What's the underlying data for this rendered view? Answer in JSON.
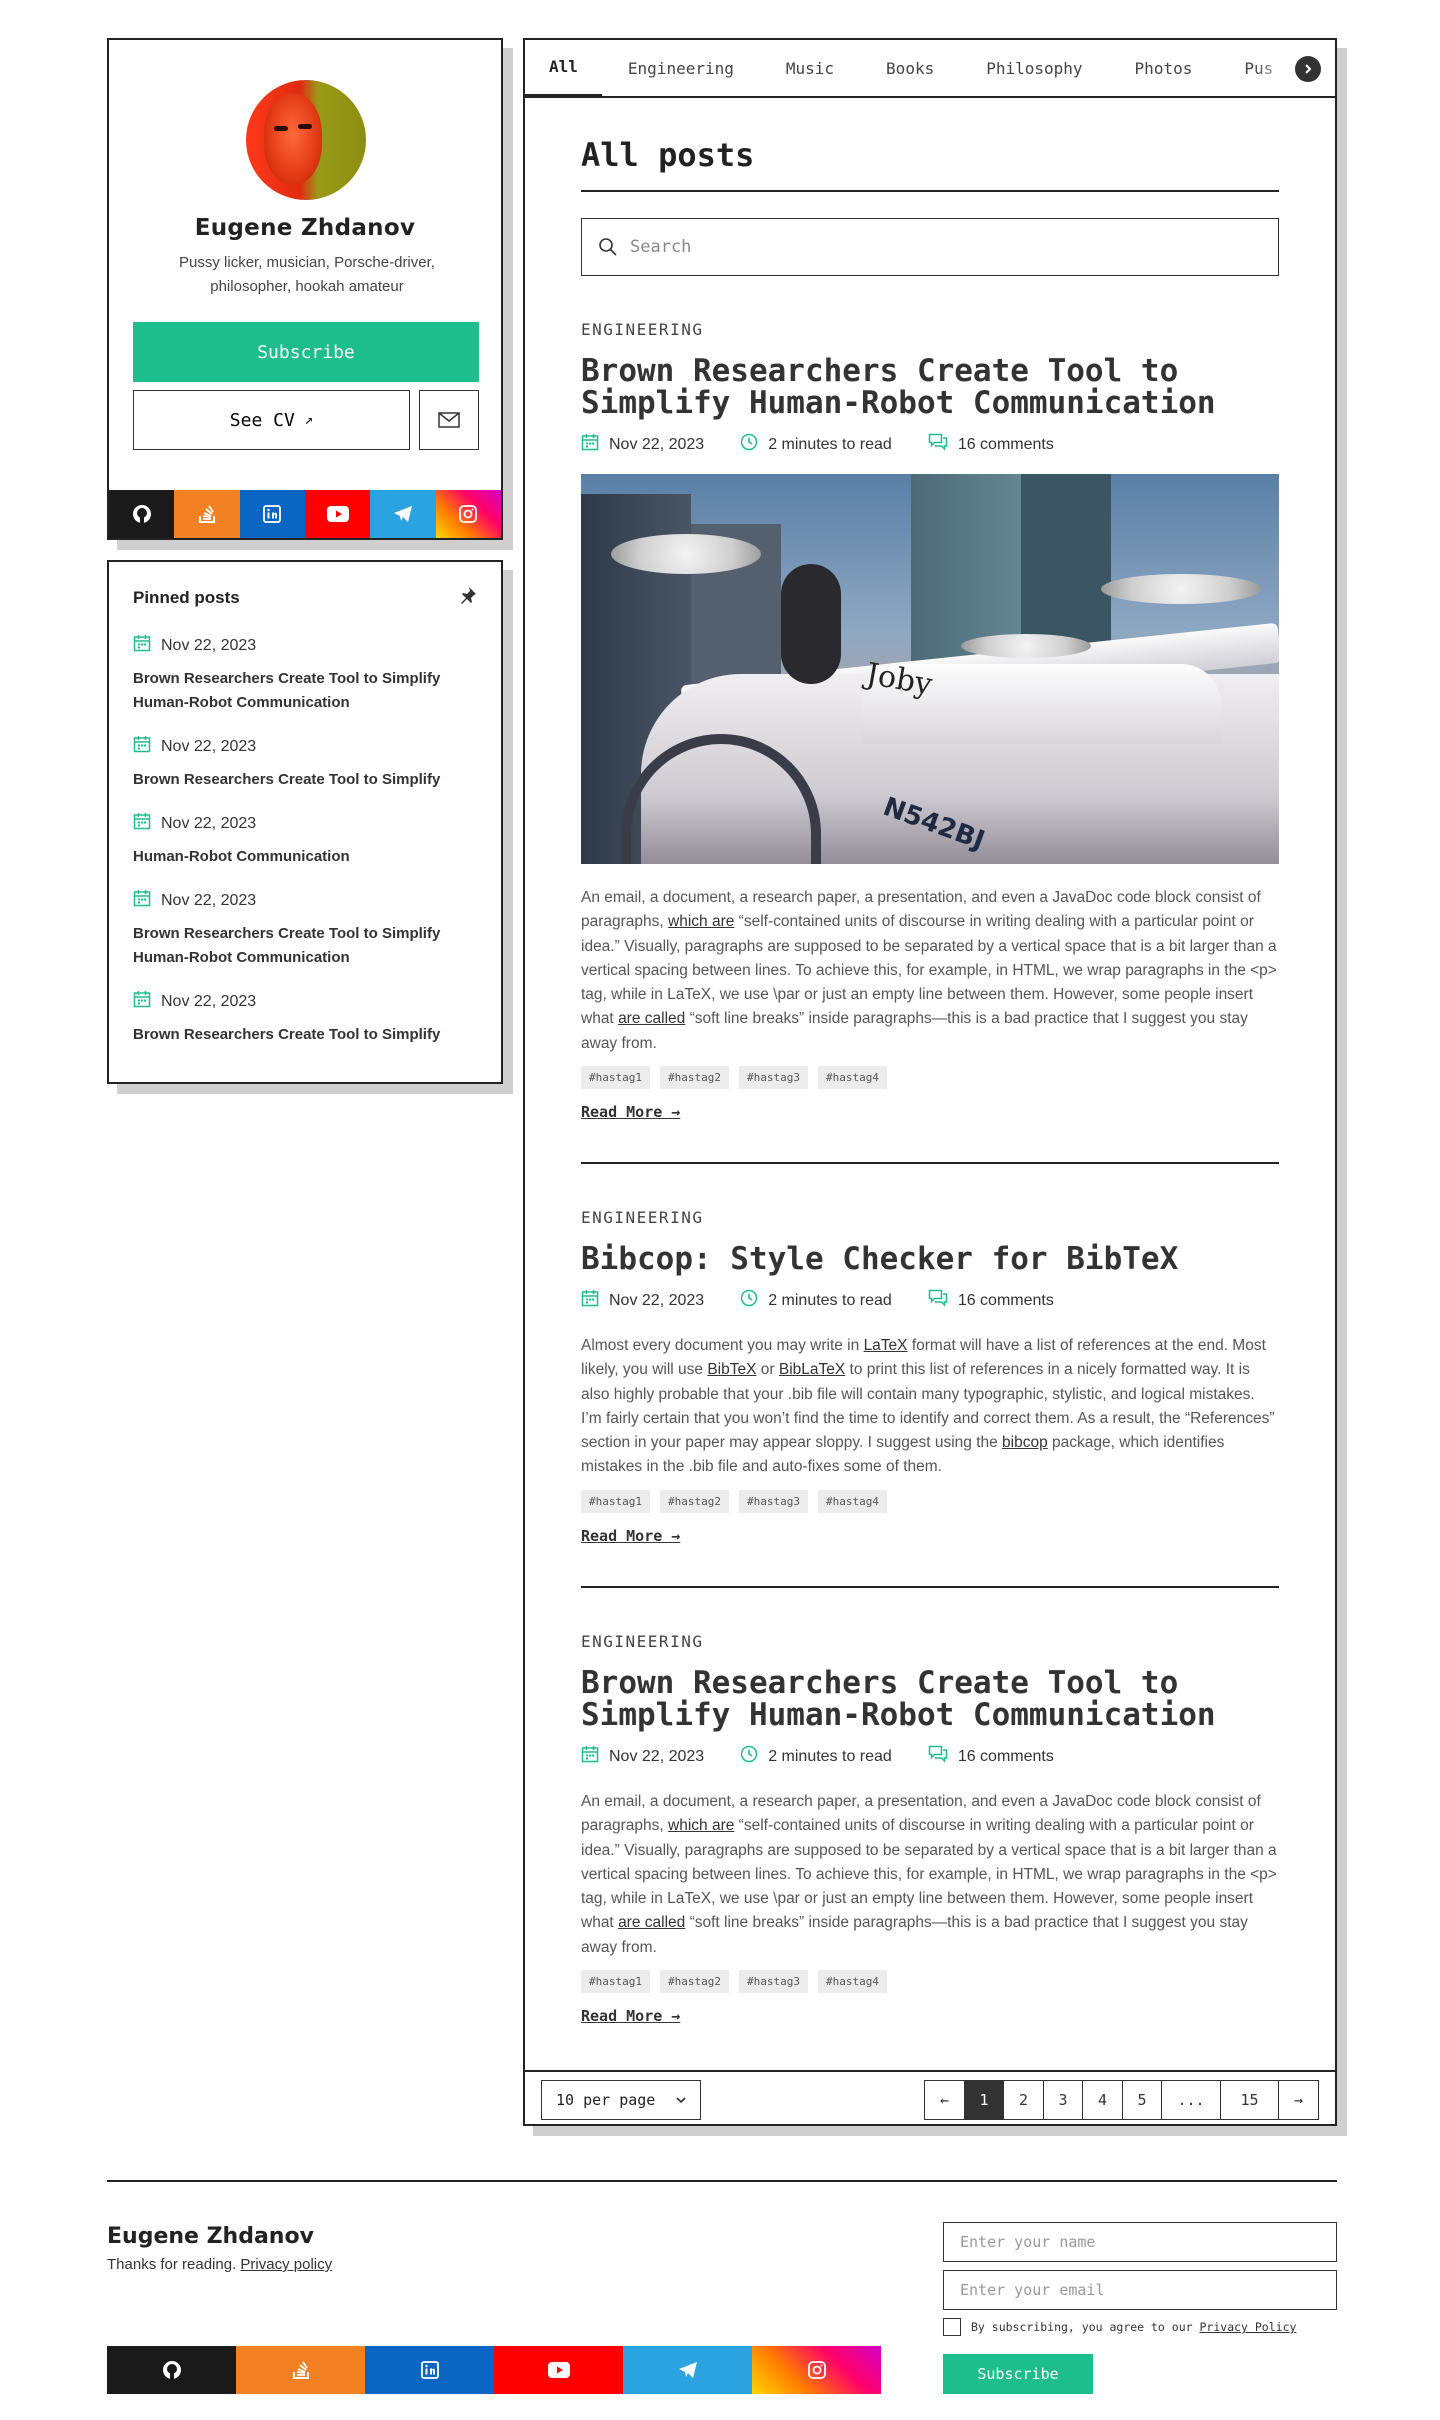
{
  "profile": {
    "name": "Eugene Zhdanov",
    "bio": "Pussy licker, musician, Porsche-driver, philosopher, hookah amateur",
    "subscribe_label": "Subscribe",
    "cv_label": "See CV",
    "cv_arrow": "↗",
    "socials": [
      "github-icon",
      "stackoverflow-icon",
      "linkedin-icon",
      "youtube-icon",
      "telegram-icon",
      "instagram-icon"
    ]
  },
  "pinned": {
    "title": "Pinned posts",
    "items": [
      {
        "date": "Nov 22, 2023",
        "title": "Brown Researchers Create Tool to Simplify Human-Robot Communication"
      },
      {
        "date": "Nov 22, 2023",
        "title": "Brown Researchers Create Tool to Simplify"
      },
      {
        "date": "Nov 22, 2023",
        "title": "Human-Robot Communication"
      },
      {
        "date": "Nov 22, 2023",
        "title": "Brown Researchers Create Tool to Simplify Human-Robot Communication"
      },
      {
        "date": "Nov 22, 2023",
        "title": "Brown Researchers Create Tool to Simplify"
      }
    ]
  },
  "tabs": [
    "All",
    "Engineering",
    "Music",
    "Books",
    "Philosophy",
    "Photos",
    "Pus"
  ],
  "main": {
    "title": "All posts",
    "search_placeholder": "Search"
  },
  "posts": [
    {
      "category": "ENGINEERING",
      "title": "Brown Researchers Create Tool to Simplify Human-Robot Communication",
      "date": "Nov 22, 2023",
      "read_time": "2 minutes to read",
      "comments": "16 comments",
      "image_label": "Joby",
      "image_tail": "N542BJ",
      "excerpt": {
        "a": "An email, a document, a research paper, a presentation, and even a JavaDoc code block consist of paragraphs, ",
        "link1": "which are",
        "b": " “self-contained units of discourse in writing dealing with a particular point or idea.” Visually, paragraphs are supposed to be separated by a vertical space that is a bit larger than a vertical spacing between lines. To achieve this, for example, in HTML, we wrap paragraphs in the <p> tag, while in LaTeX, we use \\par or just an empty line between them. However, some people insert what ",
        "link2": "are called",
        "c": " “soft line breaks” inside paragraphs—this is a bad practice that I suggest you stay away from."
      },
      "tags": [
        "#hastag1",
        "#hastag2",
        "#hastag3",
        "#hastag4"
      ],
      "read_more": "Read More →"
    },
    {
      "category": "ENGINEERING",
      "title": "Bibcop: Style Checker for BibTeX",
      "date": "Nov 22, 2023",
      "read_time": "2 minutes to read",
      "comments": "16 comments",
      "excerpt": {
        "a": "Almost every document you may write in ",
        "l1": "LaTeX",
        "b": " format will have a list of references at the end. Most likely, you will use ",
        "l2": "BibTeX",
        "c": " or ",
        "l3": "BibLaTeX",
        "d": " to print this list of references in a nicely formatted way. It is also highly probable that your .bib file will contain many typographic, stylistic, and logical mistakes. I’m fairly certain that you won’t find the time to identify and correct them. As a result, the “References” section in your paper may appear sloppy. I suggest using the ",
        "l4": "bibcop",
        "e": " package, which identifies mistakes in the .bib file and auto-fixes some of them."
      },
      "tags": [
        "#hastag1",
        "#hastag2",
        "#hastag3",
        "#hastag4"
      ],
      "read_more": "Read More →"
    },
    {
      "category": "ENGINEERING",
      "title": "Brown Researchers Create Tool to Simplify Human-Robot Communication",
      "date": "Nov 22, 2023",
      "read_time": "2 minutes to read",
      "comments": "16 comments",
      "excerpt": {
        "a": "An email, a document, a research paper, a presentation, and even a JavaDoc code block consist of paragraphs, ",
        "link1": "which are",
        "b": " “self-contained units of discourse in writing dealing with a particular point or idea.” Visually, paragraphs are supposed to be separated by a vertical space that is a bit larger than a vertical spacing between lines. To achieve this, for example, in HTML, we wrap paragraphs in the <p> tag, while in LaTeX, we use \\par or just an empty line between them. However, some people insert what ",
        "link2": "are called",
        "c": " “soft line breaks” inside paragraphs—this is a bad practice that I suggest you stay away from."
      },
      "tags": [
        "#hastag1",
        "#hastag2",
        "#hastag3",
        "#hastag4"
      ],
      "read_more": "Read More →"
    }
  ],
  "pagination": {
    "per_page": "10 per page",
    "prev": "←",
    "pages": [
      "1",
      "2",
      "3",
      "4",
      "5",
      "...",
      "15"
    ],
    "current": "1",
    "next": "→"
  },
  "footer": {
    "name": "Eugene Zhdanov",
    "thanks": "Thanks for reading.",
    "privacy": "Privacy policy",
    "name_placeholder": "Enter your name",
    "email_placeholder": "Enter your email",
    "agree_text": "By subscribing, you agree to our",
    "agree_link": "Privacy Policy",
    "subscribe_label": "Subscribe"
  },
  "colors": {
    "accent": "#1ebd8c",
    "ink": "#222222",
    "shadow": "#cfcfcf"
  }
}
